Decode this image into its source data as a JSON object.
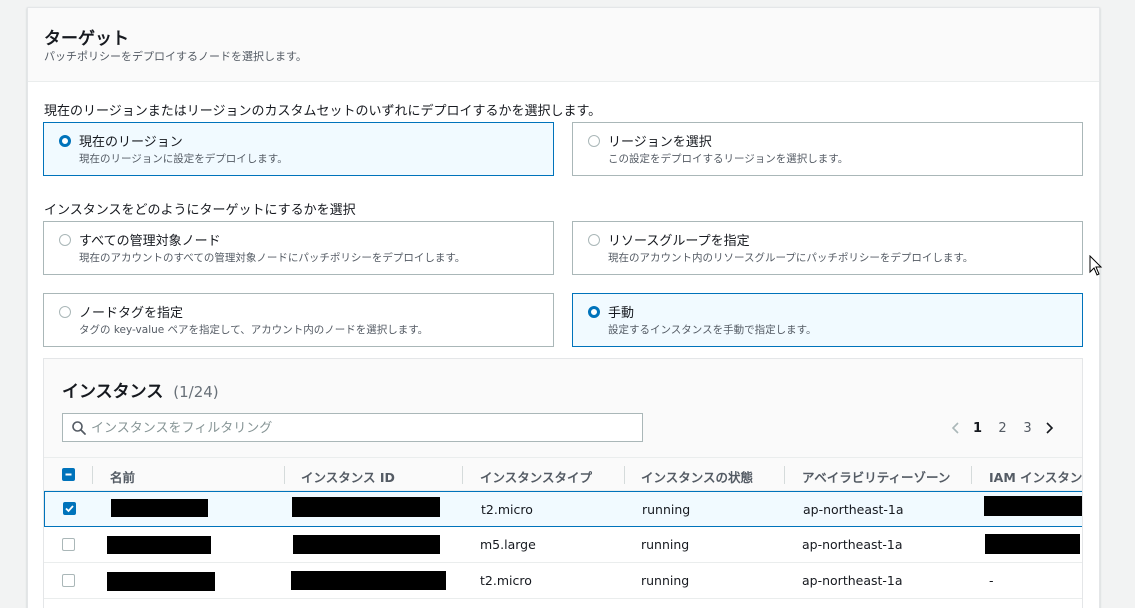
{
  "card": {
    "title": "ターゲット",
    "description": "パッチポリシーをデプロイするノードを選択します。"
  },
  "region_section": {
    "label": "現在のリージョンまたはリージョンのカスタムセットのいずれにデプロイするかを選択します。",
    "options": [
      {
        "title": "現在のリージョン",
        "description": "現在のリージョンに設定をデプロイします。",
        "selected": true
      },
      {
        "title": "リージョンを選択",
        "description": "この設定をデプロイするリージョンを選択します。",
        "selected": false
      }
    ]
  },
  "target_section": {
    "label": "インスタンスをどのようにターゲットにするかを選択",
    "options": [
      {
        "title": "すべての管理対象ノード",
        "description": "現在のアカウントのすべての管理対象ノードにパッチポリシーをデプロイします。",
        "selected": false
      },
      {
        "title": "リソースグループを指定",
        "description": "現在のアカウント内のリソースグループにパッチポリシーをデプロイします。",
        "selected": false
      },
      {
        "title": "ノードタグを指定",
        "description": "タグの key-value ペアを指定して、アカウント内のノードを選択します。",
        "selected": false
      },
      {
        "title": "手動",
        "description": "設定するインスタンスを手動で指定します。",
        "selected": true
      }
    ]
  },
  "instances": {
    "title": "インスタンス",
    "count": "(1/24)",
    "search_placeholder": "インスタンスをフィルタリング",
    "pagination": {
      "pages": [
        "1",
        "2",
        "3"
      ],
      "current": "1"
    },
    "columns": [
      "名前",
      "インスタンス ID",
      "インスタンスタイプ",
      "インスタンスの状態",
      "アベイラビリティーゾーン",
      "IAM インスタンス"
    ],
    "rows": [
      {
        "checked": true,
        "type": "t2.micro",
        "state": "running",
        "az": "ap-northeast-1a",
        "iam": ""
      },
      {
        "checked": false,
        "type": "m5.large",
        "state": "running",
        "az": "ap-northeast-1a",
        "iam": ""
      },
      {
        "checked": false,
        "type": "t2.micro",
        "state": "running",
        "az": "ap-northeast-1a",
        "iam": "-"
      }
    ]
  },
  "colors": {
    "accent": "#0073bb",
    "selected_bg": "#f1faff",
    "border": "#aab7b8"
  }
}
